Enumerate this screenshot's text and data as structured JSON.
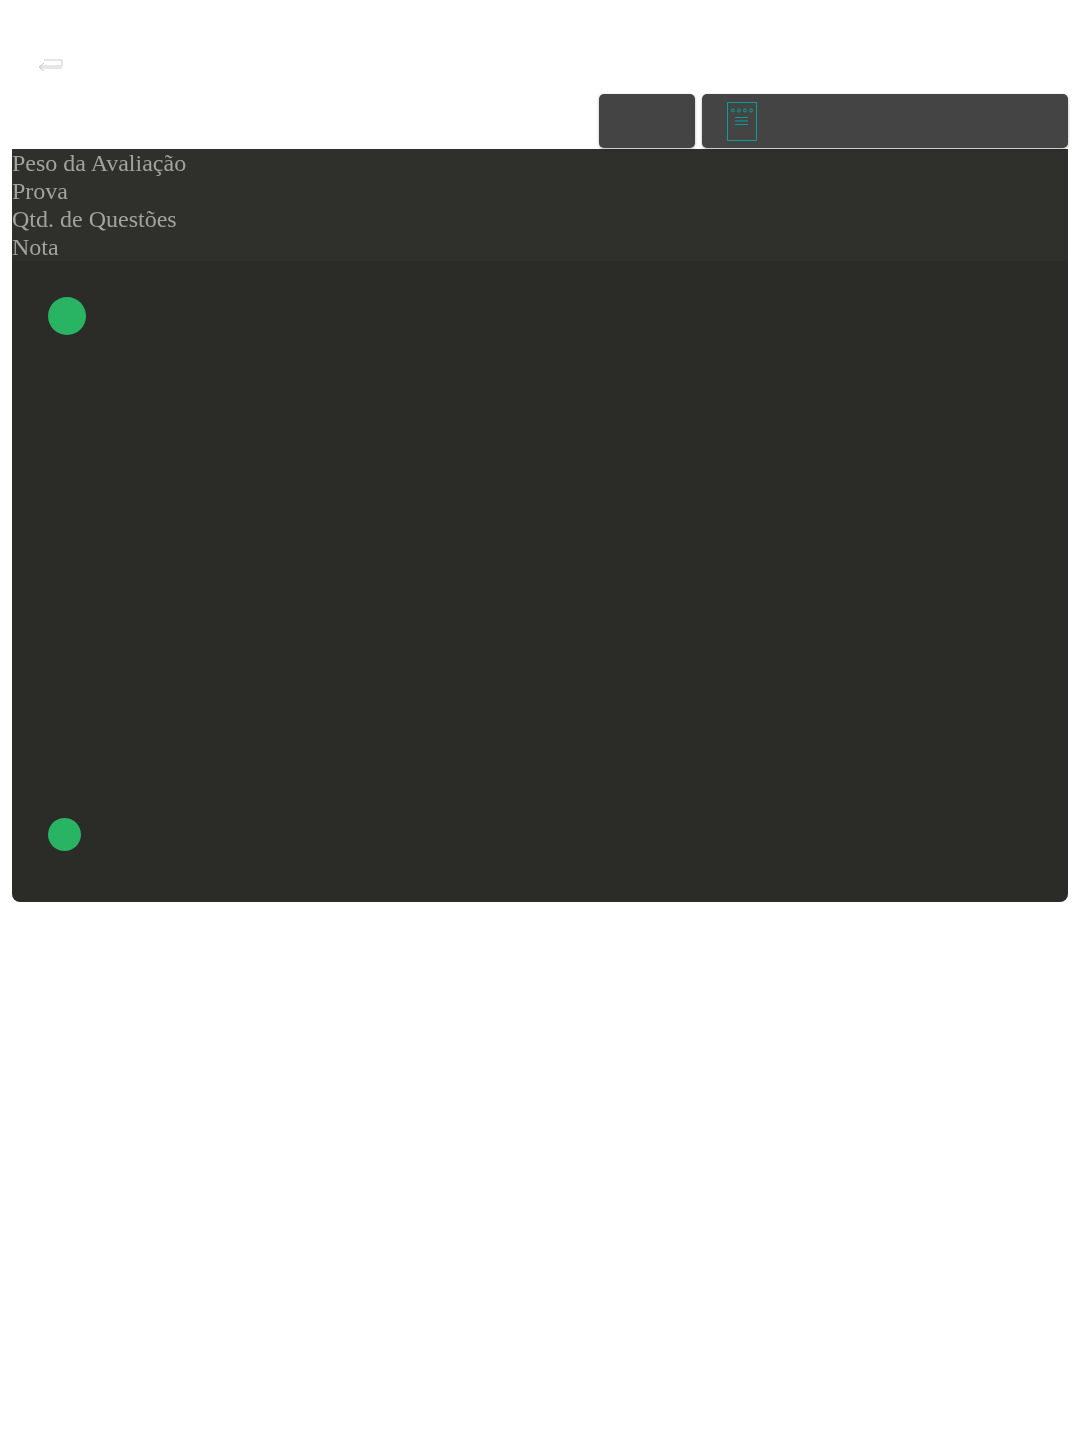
{
  "labels": [
    "Peso da Avaliação",
    "Prova",
    "Qtd. de Questões",
    "Nota"
  ]
}
